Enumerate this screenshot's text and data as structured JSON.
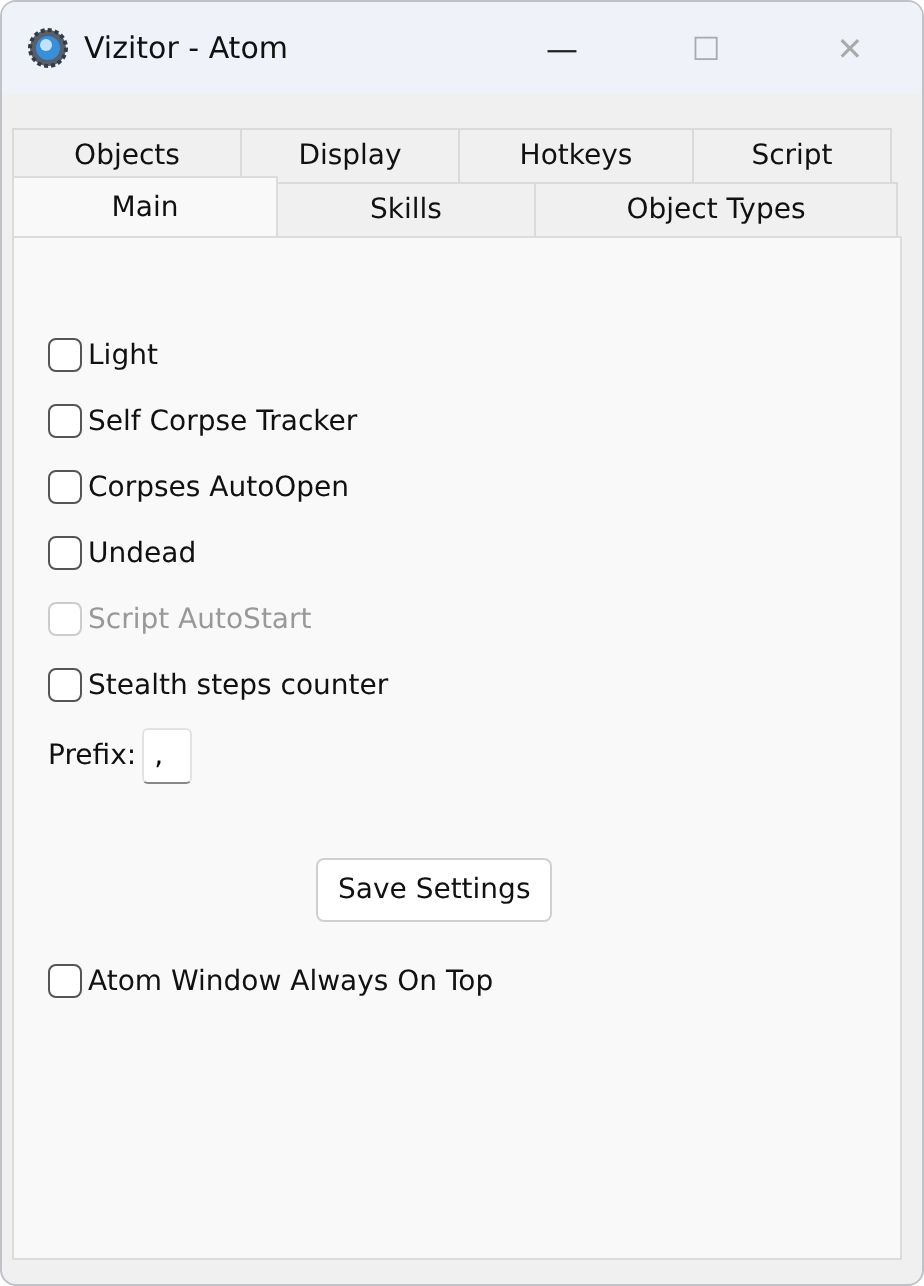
{
  "window": {
    "title": "Vizitor - Atom",
    "controls": [
      "—",
      "☐",
      "✕"
    ]
  },
  "tab_rows": [
    [
      {
        "label": "Objects",
        "selected": false
      },
      {
        "label": "Display",
        "selected": false
      },
      {
        "label": "Hotkeys",
        "selected": false
      },
      {
        "label": "Script",
        "selected": false
      }
    ],
    [
      {
        "label": "Main",
        "selected": true
      },
      {
        "label": "Skills",
        "selected": false
      },
      {
        "label": "Object Types",
        "selected": false
      }
    ]
  ],
  "options": [
    {
      "label": "Light",
      "checked": false,
      "disabled": false
    },
    {
      "label": "Self Corpse Tracker",
      "checked": false,
      "disabled": false
    },
    {
      "label": "Corpses AutoOpen",
      "checked": false,
      "disabled": false
    },
    {
      "label": "Undead",
      "checked": false,
      "disabled": false
    },
    {
      "label": "Script AutoStart",
      "checked": false,
      "disabled": true
    },
    {
      "label": "Stealth steps counter",
      "checked": false,
      "disabled": false
    }
  ],
  "prefix": {
    "label": "Prefix:",
    "value": ","
  },
  "save_button": "Save Settings",
  "always_on_top": {
    "label": "Atom Window Always On Top",
    "checked": false,
    "disabled": false
  }
}
